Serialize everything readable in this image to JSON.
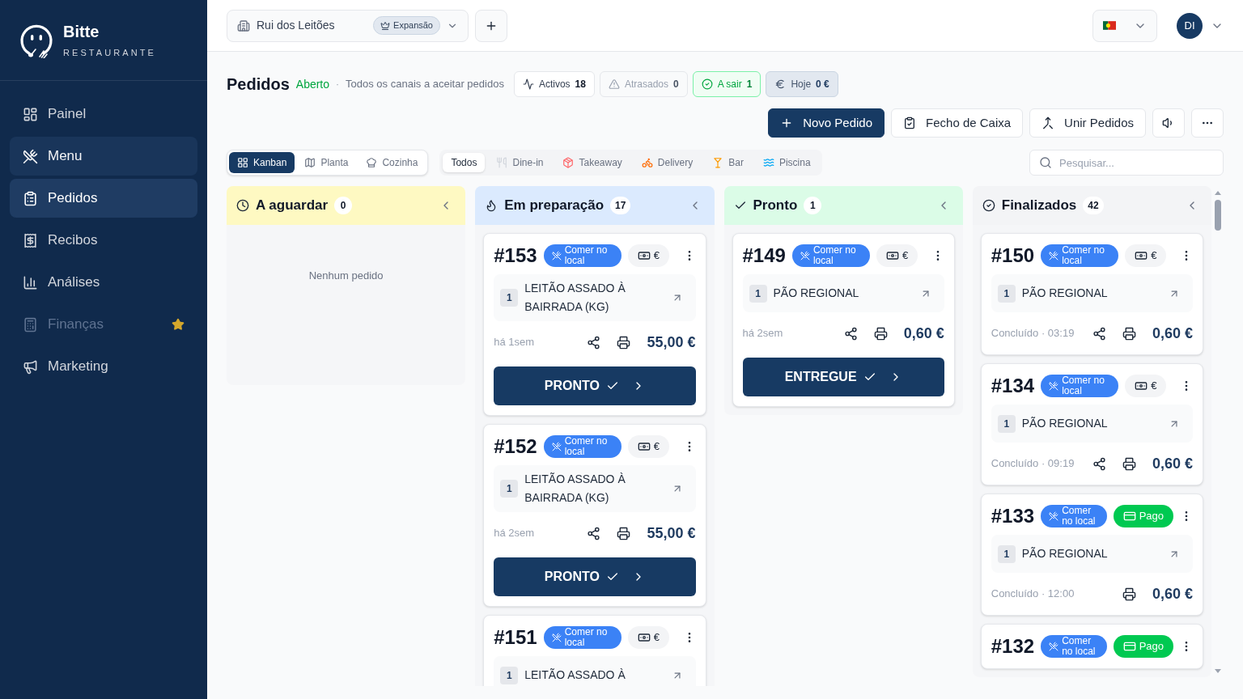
{
  "sidebar": {
    "brand": {
      "name": "Bitte",
      "tagline": "RESTAURANTE"
    },
    "items": [
      {
        "label": "Painel",
        "selected": false,
        "hovered": false,
        "disabled": false,
        "starred": false
      },
      {
        "label": "Menu",
        "selected": false,
        "hovered": true,
        "disabled": false,
        "starred": false
      },
      {
        "label": "Pedidos",
        "selected": true,
        "hovered": false,
        "disabled": false,
        "starred": false
      },
      {
        "label": "Recibos",
        "selected": false,
        "hovered": false,
        "disabled": false,
        "starred": false
      },
      {
        "label": "Análises",
        "selected": false,
        "hovered": false,
        "disabled": false,
        "starred": false
      },
      {
        "label": "Finanças",
        "selected": false,
        "hovered": false,
        "disabled": true,
        "starred": true
      },
      {
        "label": "Marketing",
        "selected": false,
        "hovered": false,
        "disabled": false,
        "starred": false
      }
    ]
  },
  "header": {
    "store": {
      "name": "Rui dos Leitões",
      "plan": "Expansão"
    },
    "user": {
      "initials": "DI"
    }
  },
  "page": {
    "title": "Pedidos",
    "status": "Aberto",
    "separator": "·",
    "subtitle": "Todos os canais a aceitar pedidos",
    "stats": [
      {
        "kind": "neutral",
        "label": "Activos",
        "value": "18"
      },
      {
        "kind": "muted",
        "label": "Atrasados",
        "value": "0"
      },
      {
        "kind": "success",
        "label": "A sair",
        "value": "1"
      },
      {
        "kind": "info",
        "label": "Hoje",
        "value": "0 €"
      }
    ],
    "actions": [
      {
        "kind": "primary",
        "label": "Novo Pedido"
      },
      {
        "kind": "secondary",
        "label": "Fecho de Caixa"
      },
      {
        "kind": "secondary",
        "label": "Unir Pedidos"
      }
    ]
  },
  "views": [
    {
      "label": "Kanban",
      "selected": true
    },
    {
      "label": "Planta",
      "selected": false
    },
    {
      "label": "Cozinha",
      "selected": false
    }
  ],
  "channels": [
    {
      "label": "Todos",
      "selected": true
    },
    {
      "label": "Dine-in",
      "selected": false
    },
    {
      "label": "Takeaway",
      "selected": false
    },
    {
      "label": "Delivery",
      "selected": false
    },
    {
      "label": "Bar",
      "selected": false
    },
    {
      "label": "Piscina",
      "selected": false
    }
  ],
  "search": {
    "placeholder": "Pesquisar..."
  },
  "columns": [
    {
      "kind": "waiting",
      "title": "A aguardar",
      "count": "0",
      "empty_text": "Nenhum pedido"
    },
    {
      "kind": "preparing",
      "title": "Em preparação",
      "count": "17",
      "orders": [
        {
          "number": "#153",
          "channel": "Comer no local",
          "payment": {
            "kind": "cash",
            "label": "€"
          },
          "items": [
            {
              "qty": "1",
              "name": "LEITÃO ASSADO À BAIRRADA (KG)"
            }
          ],
          "time": "há 1sem",
          "share": true,
          "total": "55,00 €",
          "action": "PRONTO"
        },
        {
          "number": "#152",
          "channel": "Comer no local",
          "payment": {
            "kind": "cash",
            "label": "€"
          },
          "items": [
            {
              "qty": "1",
              "name": "LEITÃO ASSADO À BAIRRADA (KG)"
            }
          ],
          "time": "há 2sem",
          "share": true,
          "total": "55,00 €",
          "action": "PRONTO"
        },
        {
          "number": "#151",
          "channel": "Comer no local",
          "payment": {
            "kind": "cash",
            "label": "€"
          },
          "items": [
            {
              "qty": "1",
              "name": "LEITÃO ASSADO À"
            }
          ]
        }
      ]
    },
    {
      "kind": "ready",
      "title": "Pronto",
      "count": "1",
      "orders": [
        {
          "number": "#149",
          "channel": "Comer no local",
          "payment": {
            "kind": "cash",
            "label": "€"
          },
          "items": [
            {
              "qty": "1",
              "name": "PÃO REGIONAL"
            }
          ],
          "time": "há 2sem",
          "share": true,
          "total": "0,60 €",
          "action": "ENTREGUE"
        }
      ]
    },
    {
      "kind": "done",
      "title": "Finalizados",
      "count": "42",
      "orders": [
        {
          "number": "#150",
          "channel": "Comer no local",
          "payment": {
            "kind": "cash",
            "label": "€"
          },
          "items": [
            {
              "qty": "1",
              "name": "PÃO REGIONAL"
            }
          ],
          "time": "Concluído · 03:19",
          "share": true,
          "total": "0,60 €"
        },
        {
          "number": "#134",
          "channel": "Comer no local",
          "payment": {
            "kind": "cash",
            "label": "€"
          },
          "items": [
            {
              "qty": "1",
              "name": "PÃO REGIONAL"
            }
          ],
          "time": "Concluído · 09:19",
          "share": true,
          "total": "0,60 €"
        },
        {
          "number": "#133",
          "channel": "Comer no local",
          "payment": {
            "kind": "paid",
            "label": "Pago"
          },
          "items": [
            {
              "qty": "1",
              "name": "PÃO REGIONAL"
            }
          ],
          "time": "Concluído · 12:00",
          "share": false,
          "total": "0,60 €"
        },
        {
          "number": "#132",
          "channel": "Comer no local",
          "payment": {
            "kind": "paid",
            "label": "Pago"
          }
        }
      ]
    }
  ]
}
